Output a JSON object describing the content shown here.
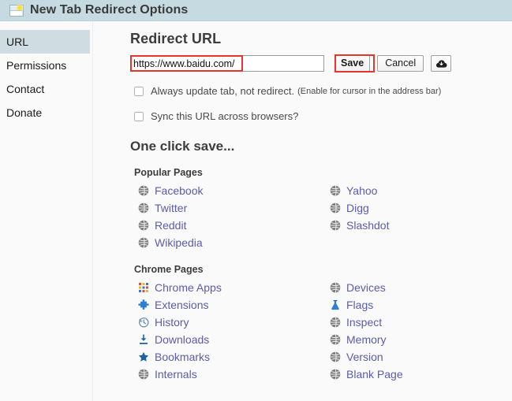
{
  "window": {
    "title": "New Tab Redirect Options",
    "icon": "photo-landscape-icon"
  },
  "sidebar": {
    "items": [
      {
        "label": "URL",
        "active": true
      },
      {
        "label": "Permissions",
        "active": false
      },
      {
        "label": "Contact",
        "active": false
      },
      {
        "label": "Donate",
        "active": false
      }
    ]
  },
  "main": {
    "section_title": "Redirect URL",
    "url_field": {
      "value": "https://www.baidu.com/",
      "placeholder": "",
      "highlighted": true
    },
    "buttons": {
      "save": "Save",
      "cancel": "Cancel",
      "cloud_icon": "cloud-download-icon"
    },
    "annotations": {
      "url_box_color": "#e8342a",
      "save_box_color": "#e8342a"
    },
    "checkboxes": [
      {
        "label": "Always update tab, not redirect.",
        "note": "(Enable for cursor in the address bar)",
        "checked": false
      },
      {
        "label": "Sync this URL across browsers?",
        "note": "",
        "checked": false
      }
    ],
    "one_click_save_title": "One click save...",
    "groups": [
      {
        "title": "Popular Pages",
        "left": [
          {
            "label": "Facebook",
            "icon": "globe-icon"
          },
          {
            "label": "Twitter",
            "icon": "globe-icon"
          },
          {
            "label": "Reddit",
            "icon": "globe-icon"
          },
          {
            "label": "Wikipedia",
            "icon": "globe-icon"
          }
        ],
        "right": [
          {
            "label": "Yahoo",
            "icon": "globe-icon"
          },
          {
            "label": "Digg",
            "icon": "globe-icon"
          },
          {
            "label": "Slashdot",
            "icon": "globe-icon"
          }
        ]
      },
      {
        "title": "Chrome Pages",
        "left": [
          {
            "label": "Chrome Apps",
            "icon": "apps-grid-icon"
          },
          {
            "label": "Extensions",
            "icon": "puzzle-icon"
          },
          {
            "label": "History",
            "icon": "clock-history-icon"
          },
          {
            "label": "Downloads",
            "icon": "download-icon"
          },
          {
            "label": "Bookmarks",
            "icon": "star-icon"
          },
          {
            "label": "Internals",
            "icon": "globe-icon"
          }
        ],
        "right": [
          {
            "label": "Devices",
            "icon": "globe-icon"
          },
          {
            "label": "Flags",
            "icon": "flask-icon"
          },
          {
            "label": "Inspect",
            "icon": "globe-icon"
          },
          {
            "label": "Memory",
            "icon": "globe-icon"
          },
          {
            "label": "Version",
            "icon": "globe-icon"
          },
          {
            "label": "Blank Page",
            "icon": "globe-icon"
          }
        ]
      }
    ]
  },
  "colors": {
    "titlebar_bg": "#c5dbe1",
    "sidebar_active_bg": "#cfdde2",
    "link": "#5b5bad",
    "page_bg": "#fafafa",
    "annotation_red": "#e8342a"
  }
}
